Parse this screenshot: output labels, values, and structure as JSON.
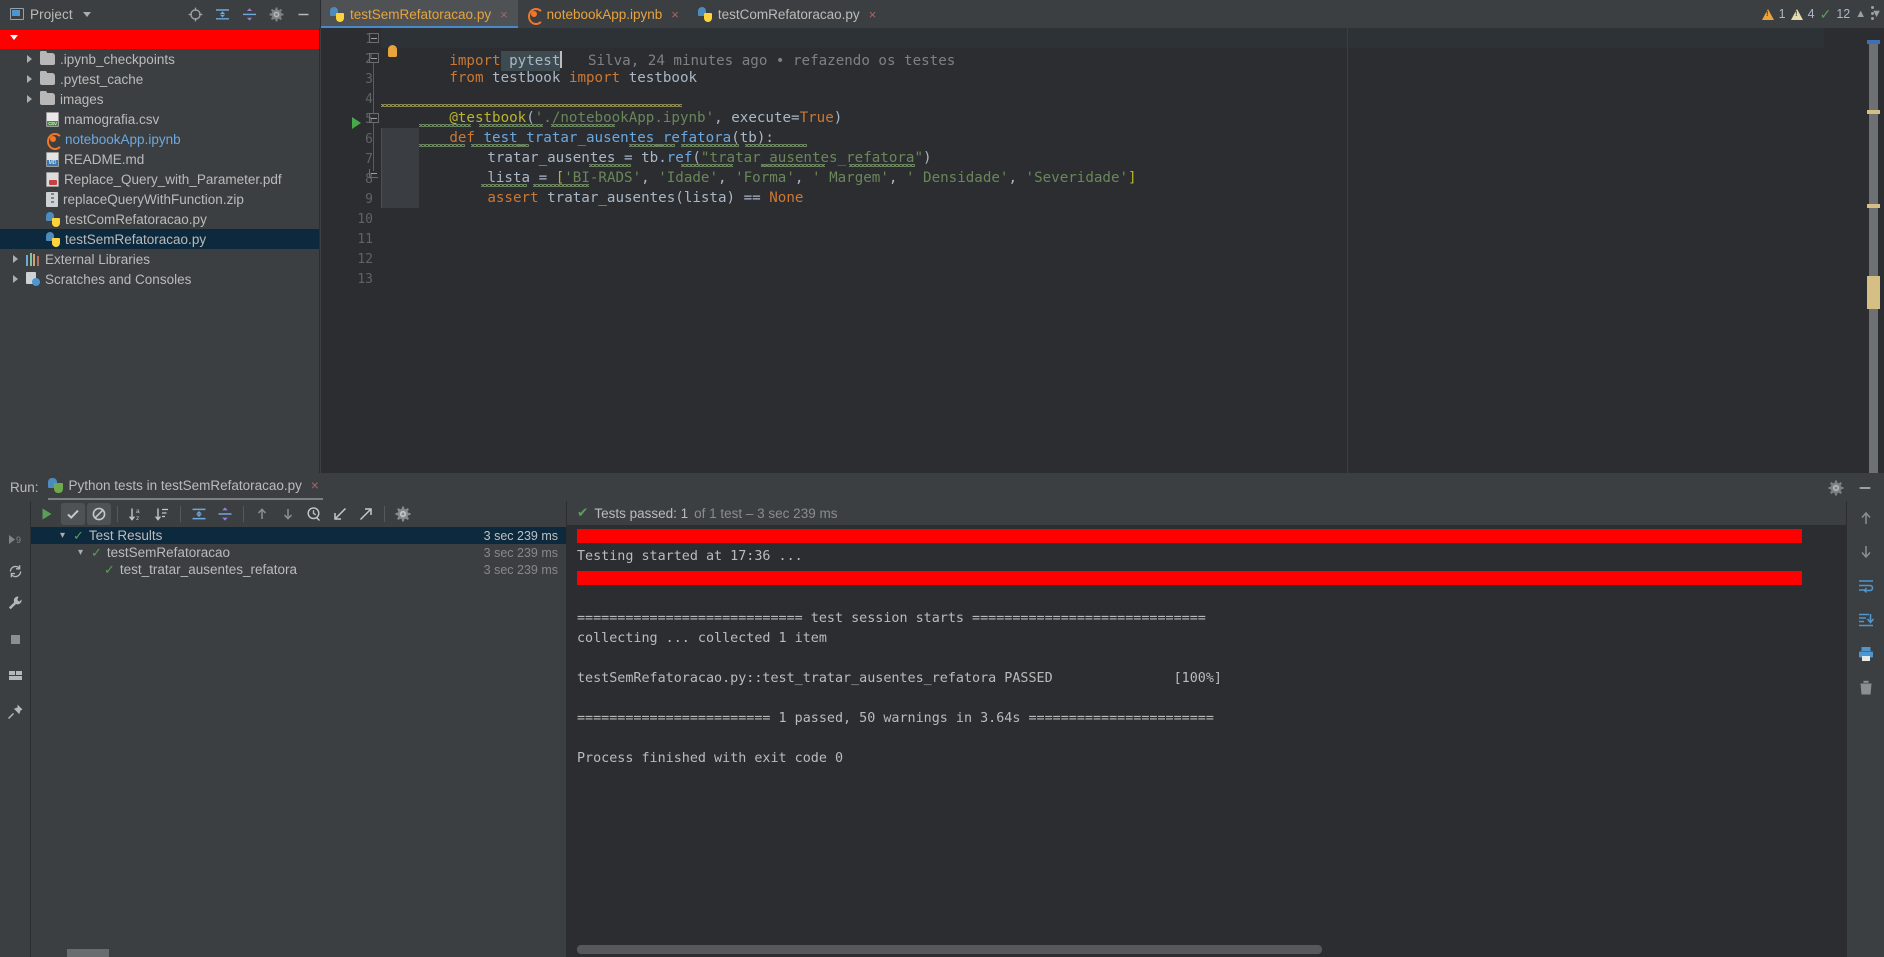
{
  "project_panel": {
    "title": "Project",
    "icons": [
      "locate-icon",
      "expand-all-icon",
      "collapse-all-icon",
      "gear-icon",
      "minimize-icon"
    ],
    "tree": [
      {
        "label": "",
        "type": "redacted-root",
        "indent": 0,
        "arrow": "open",
        "icon": "none",
        "selected": false
      },
      {
        "label": ".ipynb_checkpoints",
        "type": "folder",
        "indent": 1,
        "arrow": "closed",
        "icon": "folder-icon",
        "selected": false
      },
      {
        "label": ".pytest_cache",
        "type": "folder",
        "indent": 1,
        "arrow": "closed",
        "icon": "folder-icon",
        "selected": false
      },
      {
        "label": "images",
        "type": "folder",
        "indent": 1,
        "arrow": "closed",
        "icon": "folder-icon",
        "selected": false
      },
      {
        "label": "mamografia.csv",
        "type": "file",
        "indent": 1,
        "arrow": "none",
        "icon": "csv-file-icon",
        "selected": false
      },
      {
        "label": "notebookApp.ipynb",
        "type": "file",
        "indent": 1,
        "arrow": "none",
        "icon": "jupyter-file-icon",
        "selected": false,
        "link": true
      },
      {
        "label": "README.md",
        "type": "file",
        "indent": 1,
        "arrow": "none",
        "icon": "markdown-file-icon",
        "selected": false
      },
      {
        "label": "Replace_Query_with_Parameter.pdf",
        "type": "file",
        "indent": 1,
        "arrow": "none",
        "icon": "pdf-file-icon",
        "selected": false
      },
      {
        "label": "replaceQueryWithFunction.zip",
        "type": "file",
        "indent": 1,
        "arrow": "none",
        "icon": "zip-file-icon",
        "selected": false
      },
      {
        "label": "testComRefatoracao.py",
        "type": "file",
        "indent": 1,
        "arrow": "none",
        "icon": "python-file-icon",
        "selected": false
      },
      {
        "label": "testSemRefatoracao.py",
        "type": "file",
        "indent": 1,
        "arrow": "none",
        "icon": "python-file-icon",
        "selected": true
      },
      {
        "label": "External Libraries",
        "type": "node",
        "indent": 0,
        "arrow": "closed",
        "icon": "libraries-icon",
        "selected": false
      },
      {
        "label": "Scratches and Consoles",
        "type": "node",
        "indent": 0,
        "arrow": "closed",
        "icon": "scratches-icon",
        "selected": false
      }
    ]
  },
  "editor_tabs": [
    {
      "label": "testSemRefatoracao.py",
      "icon": "python-file-icon",
      "active": true,
      "close": "×"
    },
    {
      "label": "notebookApp.ipynb",
      "icon": "jupyter-file-icon",
      "active": false,
      "close": "×"
    },
    {
      "label": "testComRefatoracao.py",
      "icon": "python-file-icon",
      "active": false,
      "close": "×"
    }
  ],
  "editor": {
    "inline_blame": "Silva, 24 minutes ago • refazendo os testes",
    "line_numbers": [
      "1",
      "2",
      "3",
      "4",
      "5",
      "6",
      "7",
      "8",
      "9",
      "10",
      "11",
      "12",
      "13"
    ],
    "code": {
      "l1_kw": "import",
      "l1_mod": " pytest",
      "l2_from": "from",
      "l2_mid": " testbook ",
      "l2_import": "import",
      "l2_mod": " testbook",
      "l4_deco": "@testbook",
      "l4_open": "(",
      "l4_path": "'./notebookApp.ipynb'",
      "l4_comma": ", ",
      "l4_kwarg": "execute=",
      "l4_true": "True",
      "l4_close": ")",
      "l5_def": "def",
      "l5_name": " test_tratar_ausentes_refatora",
      "l5_args": "(tb):",
      "l6_var": "tratar_ausentes = ",
      "l6_obj": "tb",
      "l6_dot": ".",
      "l6_meth": "ref",
      "l6_p1": "(",
      "l6_str": "\"tratar_ausentes_refatora\"",
      "l6_p2": ")",
      "l7_var": "lista = ",
      "l7_b1": "[",
      "l7_s1": "'BI-RADS'",
      "l7_s2": "'Idade'",
      "l7_s3": "'Forma'",
      "l7_s4": "' Margem'",
      "l7_s5": "' Densidade'",
      "l7_s6": "'Severidade'",
      "l7_b2": "]",
      "l7_sep": ", ",
      "l8_assert": "assert",
      "l8_call": " tratar_ausentes",
      "l8_p1": "(",
      "l8_arg": "lista",
      "l8_p2": ")",
      "l8_eq": " == ",
      "l8_none": "None"
    },
    "inspections": {
      "error_count": "1",
      "warning_count": "4",
      "ok_count": "12",
      "error_icon": "warning-triangle-orange-icon",
      "warning_icon": "warning-triangle-pale-icon",
      "ok_icon": "green-check-icon",
      "up_icon": "chevron-up-icon",
      "down_icon": "chevron-down-icon"
    }
  },
  "run_panel": {
    "label": "Run:",
    "tab_title": "Python tests in testSemRefatoracao.py",
    "tab_icon": "pytest-icon",
    "tab_close": "×",
    "header_icons": [
      "gear-icon",
      "minimize-icon"
    ],
    "toolbar": [
      {
        "name": "rerun-button",
        "icon": "green-play-icon"
      },
      {
        "name": "show-passed-toggle",
        "icon": "check-icon",
        "active": true
      },
      {
        "name": "show-ignored-toggle",
        "icon": "no-entry-icon",
        "active": true
      },
      {
        "name": "sort-alphabetically-button",
        "icon": "sort-az-icon"
      },
      {
        "name": "sort-by-duration-button",
        "icon": "sort-duration-icon"
      },
      {
        "name": "expand-all-button",
        "icon": "expand-all-icon"
      },
      {
        "name": "collapse-all-button",
        "icon": "collapse-all-icon"
      },
      {
        "name": "prev-failed-button",
        "icon": "arrow-up-icon"
      },
      {
        "name": "next-failed-button",
        "icon": "arrow-down-icon"
      },
      {
        "name": "test-history-button",
        "icon": "clock-icon"
      },
      {
        "name": "import-tests-button",
        "icon": "import-arrow-icon"
      },
      {
        "name": "export-tests-button",
        "icon": "export-arrow-icon"
      },
      {
        "name": "test-settings-button",
        "icon": "gear-icon"
      }
    ],
    "side_icons": [
      "debug-icon",
      "rerun-circle-icon",
      "wrench-icon",
      "stop-icon",
      "layout-icon",
      "pin-icon"
    ],
    "results": [
      {
        "label": "Test Results",
        "time": "3 sec 239 ms",
        "indent": 0,
        "expanded": true,
        "selected": true,
        "status": "passed"
      },
      {
        "label": "testSemRefatoracao",
        "time": "3 sec 239 ms",
        "indent": 1,
        "expanded": true,
        "selected": false,
        "status": "passed"
      },
      {
        "label": "test_tratar_ausentes_refatora",
        "time": "3 sec 239 ms",
        "indent": 2,
        "expanded": false,
        "selected": false,
        "status": "passed"
      }
    ],
    "status": {
      "check": "✔",
      "main": "Tests passed: 1",
      "dim": " of 1 test – 3 sec 239 ms"
    },
    "console": [
      {
        "type": "redacted"
      },
      {
        "type": "text",
        "text": "Testing started at 17:36 ..."
      },
      {
        "type": "redacted"
      },
      {
        "type": "text",
        "text": ""
      },
      {
        "type": "text",
        "text": "============================ test session starts ============================="
      },
      {
        "type": "text",
        "text": "collecting ... collected 1 item"
      },
      {
        "type": "text",
        "text": ""
      },
      {
        "type": "text",
        "text": "testSemRefatoracao.py::test_tratar_ausentes_refatora PASSED               [100%]"
      },
      {
        "type": "text",
        "text": ""
      },
      {
        "type": "text",
        "text": "======================== 1 passed, 50 warnings in 3.64s ======================="
      },
      {
        "type": "text",
        "text": ""
      },
      {
        "type": "text",
        "text": "Process finished with exit code 0"
      }
    ],
    "console_rail_icons": [
      "scroll-up-icon",
      "scroll-down-icon",
      "soft-wrap-icon",
      "scroll-to-end-icon",
      "print-icon",
      "trash-icon"
    ]
  },
  "colors": {
    "panel_bg": "#3c3f41",
    "editor_bg": "#2b2d30",
    "selection_blue": "#0d293e",
    "accent_blue": "#4a88c7",
    "pass_green": "#5a9e5a",
    "redaction": "#ff0000"
  }
}
